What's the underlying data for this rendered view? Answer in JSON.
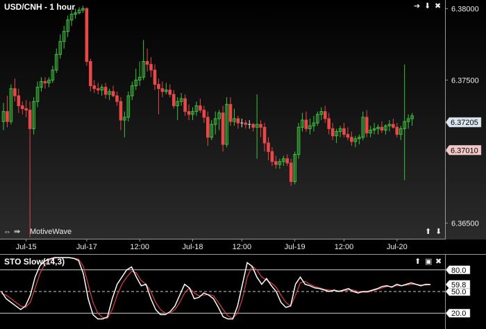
{
  "chart_data": {
    "type": "candlestick",
    "title": "USD/CNH - 1 hour",
    "watermark": "MotiveWave",
    "y_ticks": [
      "6.38000",
      "6.37500",
      "6.37000",
      "6.36500"
    ],
    "y_tick_values": [
      6.38,
      6.375,
      6.37,
      6.365
    ],
    "ylim": [
      6.3639,
      6.3806
    ],
    "x_ticks": [
      "Jul-15",
      "Jul-17",
      "12:00",
      "Jul-18",
      "12:00",
      "Jul-19",
      "12:00",
      "Jul-20"
    ],
    "x_tick_bar_index": [
      6,
      22,
      36,
      50,
      63,
      77,
      90,
      104
    ],
    "price_labels": [
      {
        "text": "6.37205",
        "value": 6.37205,
        "color": "#dce6f0"
      },
      {
        "text": "6.37010",
        "value": 6.3701,
        "color": "#f4c8c8"
      }
    ],
    "bullish_color": "#3ec43e",
    "bearish_color": "#e84848",
    "doji_color": "#e6e6e6",
    "candles_ohlc": [
      [
        6.3721,
        6.3734,
        6.3715,
        6.3728
      ],
      [
        6.3728,
        6.3739,
        6.3717,
        6.3721
      ],
      [
        6.3721,
        6.3747,
        6.3719,
        6.3744
      ],
      [
        6.3744,
        6.3751,
        6.3735,
        6.3739
      ],
      [
        6.3739,
        6.3744,
        6.3727,
        6.3732
      ],
      [
        6.3732,
        6.3735,
        6.3726,
        6.373
      ],
      [
        6.373,
        6.3736,
        6.3724,
        6.3729
      ],
      [
        6.3729,
        6.3735,
        6.364,
        6.3716
      ],
      [
        6.3716,
        6.3738,
        6.3712,
        6.3735
      ],
      [
        6.3735,
        6.3749,
        6.3731,
        6.3745
      ],
      [
        6.3745,
        6.3752,
        6.3742,
        6.3749
      ],
      [
        6.3749,
        6.3752,
        6.3744,
        6.3748
      ],
      [
        6.3748,
        6.3752,
        6.3745,
        6.375
      ],
      [
        6.375,
        6.376,
        6.3748,
        6.3757
      ],
      [
        6.3757,
        6.3772,
        6.3755,
        6.3768
      ],
      [
        6.3768,
        6.3782,
        6.3765,
        6.3777
      ],
      [
        6.3777,
        6.3788,
        6.3772,
        6.3784
      ],
      [
        6.3784,
        6.3795,
        6.378,
        6.3792
      ],
      [
        6.3792,
        6.3799,
        6.3788,
        6.3796
      ],
      [
        6.3796,
        6.38,
        6.3793,
        6.3797
      ],
      [
        6.3797,
        6.3801,
        6.3796,
        6.3799
      ],
      [
        6.3799,
        6.3802,
        6.3797,
        6.38
      ],
      [
        6.38,
        6.3801,
        6.376,
        6.3763
      ],
      [
        6.3763,
        6.3765,
        6.3742,
        6.3746
      ],
      [
        6.3746,
        6.375,
        6.3741,
        6.3744
      ],
      [
        6.3744,
        6.3748,
        6.374,
        6.3743
      ],
      [
        6.3743,
        6.3747,
        6.3739,
        6.3745
      ],
      [
        6.3745,
        6.3748,
        6.3737,
        6.374
      ],
      [
        6.374,
        6.3744,
        6.3736,
        6.3742
      ],
      [
        6.3742,
        6.3746,
        6.3738,
        6.3739
      ],
      [
        6.3739,
        6.3742,
        6.3732,
        6.3735
      ],
      [
        6.3735,
        6.3738,
        6.3715,
        6.3722
      ],
      [
        6.3722,
        6.3728,
        6.371,
        6.3724
      ],
      [
        6.3724,
        6.3742,
        6.3721,
        6.3739
      ],
      [
        6.3739,
        6.3749,
        6.3736,
        6.3746
      ],
      [
        6.3746,
        6.3758,
        6.3743,
        6.375
      ],
      [
        6.375,
        6.3763,
        6.3746,
        6.3752
      ],
      [
        6.3752,
        6.3778,
        6.375,
        6.3763
      ],
      [
        6.3763,
        6.3772,
        6.3756,
        6.3761
      ],
      [
        6.3761,
        6.3766,
        6.3752,
        6.3757
      ],
      [
        6.3757,
        6.3761,
        6.3743,
        6.3747
      ],
      [
        6.3747,
        6.3751,
        6.3726,
        6.3744
      ],
      [
        6.3744,
        6.3749,
        6.3738,
        6.3742
      ],
      [
        6.3742,
        6.3748,
        6.374,
        6.3743
      ],
      [
        6.3743,
        6.3747,
        6.3738,
        6.374
      ],
      [
        6.374,
        6.3743,
        6.373,
        6.3732
      ],
      [
        6.3732,
        6.3738,
        6.3722,
        6.3735
      ],
      [
        6.3735,
        6.3741,
        6.3732,
        6.3737
      ],
      [
        6.3737,
        6.374,
        6.3725,
        6.3728
      ],
      [
        6.3728,
        6.3733,
        6.3722,
        6.3726
      ],
      [
        6.3726,
        6.3731,
        6.3722,
        6.3728
      ],
      [
        6.3728,
        6.3735,
        6.3725,
        6.3732
      ],
      [
        6.3732,
        6.3737,
        6.3727,
        6.3729
      ],
      [
        6.3729,
        6.3732,
        6.372,
        6.3724
      ],
      [
        6.3724,
        6.3728,
        6.3704,
        6.371
      ],
      [
        6.371,
        6.3722,
        6.3708,
        6.3719
      ],
      [
        6.3719,
        6.3728,
        6.3712,
        6.3723
      ],
      [
        6.3723,
        6.3729,
        6.3715,
        6.3727
      ],
      [
        6.3727,
        6.3732,
        6.37,
        6.3705
      ],
      [
        6.3705,
        6.3738,
        6.3703,
        6.3733
      ],
      [
        6.3733,
        6.3738,
        6.3718,
        6.3721
      ],
      [
        6.3721,
        6.373,
        6.3718,
        6.3723
      ],
      [
        6.3723,
        6.3725,
        6.3716,
        6.372
      ],
      [
        6.372,
        6.3723,
        6.3717,
        6.372
      ],
      [
        6.372,
        6.3722,
        6.3716,
        6.3719
      ],
      [
        6.3719,
        6.3722,
        6.3716,
        6.3719
      ],
      [
        6.3719,
        6.372,
        6.3714,
        6.3717
      ],
      [
        6.3717,
        6.374,
        6.3695,
        6.3719
      ],
      [
        6.3719,
        6.3722,
        6.371,
        6.3717
      ],
      [
        6.3717,
        6.372,
        6.37,
        6.3706
      ],
      [
        6.3706,
        6.371,
        6.3694,
        6.37
      ],
      [
        6.37,
        6.3703,
        6.369,
        6.3693
      ],
      [
        6.3693,
        6.3697,
        6.3688,
        6.3691
      ],
      [
        6.3691,
        6.3695,
        6.3688,
        6.3693
      ],
      [
        6.3693,
        6.3697,
        6.369,
        6.3695
      ],
      [
        6.3695,
        6.3698,
        6.369,
        6.3692
      ],
      [
        6.3692,
        6.3695,
        6.3676,
        6.3679
      ],
      [
        6.3679,
        6.37,
        6.3677,
        6.3698
      ],
      [
        6.3698,
        6.372,
        6.3695,
        6.3717
      ],
      [
        6.3717,
        6.3727,
        6.3714,
        6.3722
      ],
      [
        6.3722,
        6.3728,
        6.3714,
        6.3716
      ],
      [
        6.3716,
        6.3723,
        6.3712,
        6.3718
      ],
      [
        6.3718,
        6.3725,
        6.3714,
        6.372
      ],
      [
        6.372,
        6.3728,
        6.3718,
        6.3726
      ],
      [
        6.3726,
        6.3731,
        6.3722,
        6.3728
      ],
      [
        6.3728,
        6.3732,
        6.372,
        6.3723
      ],
      [
        6.3723,
        6.3727,
        6.3712,
        6.3716
      ],
      [
        6.3716,
        6.372,
        6.3708,
        6.3711
      ],
      [
        6.3711,
        6.3716,
        6.3706,
        6.3714
      ],
      [
        6.3714,
        6.3718,
        6.371,
        6.3716
      ],
      [
        6.3716,
        6.372,
        6.371,
        6.3712
      ],
      [
        6.3712,
        6.3717,
        6.3708,
        6.371
      ],
      [
        6.371,
        6.3714,
        6.3704,
        6.3707
      ],
      [
        6.3707,
        6.3711,
        6.3703,
        6.3709
      ],
      [
        6.3709,
        6.3712,
        6.3705,
        6.371
      ],
      [
        6.371,
        6.3728,
        6.3708,
        6.3724
      ],
      [
        6.3724,
        6.3729,
        6.371,
        6.3713
      ],
      [
        6.3713,
        6.3718,
        6.371,
        6.3715
      ],
      [
        6.3715,
        6.372,
        6.3712,
        6.3716
      ],
      [
        6.3716,
        6.3719,
        6.3712,
        6.3717
      ],
      [
        6.3717,
        6.3721,
        6.3713,
        6.3715
      ],
      [
        6.3715,
        6.3719,
        6.3712,
        6.3718
      ],
      [
        6.3718,
        6.3722,
        6.3714,
        6.3719
      ],
      [
        6.3719,
        6.3723,
        6.3716,
        6.3717
      ],
      [
        6.3717,
        6.372,
        6.371,
        6.3712
      ],
      [
        6.3712,
        6.3718,
        6.3708,
        6.3716
      ],
      [
        6.3716,
        6.3761,
        6.368,
        6.3721
      ],
      [
        6.3721,
        6.3726,
        6.3716,
        6.3723
      ],
      [
        6.3723,
        6.3727,
        6.3718,
        6.3725
      ]
    ],
    "oscillator": {
      "title": "STO Slow(14,3)",
      "ylim": [
        0,
        100
      ],
      "levels": [
        {
          "label": "80.0",
          "value": 80,
          "style": "solid"
        },
        {
          "label": "50.0",
          "value": 50,
          "style": "dashed"
        },
        {
          "label": "20.0",
          "value": 20,
          "style": "solid"
        }
      ],
      "current_label": "59.8",
      "current_value": 59.8,
      "k_color": "#ffffff",
      "d_color": "#e04040",
      "k_values": [
        50,
        40,
        35,
        30,
        25,
        30,
        45,
        70,
        86,
        92,
        95,
        97,
        97,
        97,
        97,
        96,
        93,
        75,
        40,
        18,
        12,
        12,
        15,
        40,
        60,
        70,
        80,
        84,
        70,
        58,
        60,
        40,
        25,
        18,
        18,
        22,
        30,
        45,
        60,
        55,
        40,
        42,
        48,
        45,
        40,
        28,
        15,
        12,
        12,
        30,
        60,
        90,
        85,
        70,
        60,
        68,
        58,
        50,
        35,
        28,
        30,
        60,
        70,
        60,
        58,
        55,
        54,
        52,
        50,
        52,
        50,
        52,
        54,
        50,
        48,
        50,
        50,
        52,
        54,
        57,
        58,
        56,
        60,
        58,
        60,
        62,
        60,
        58,
        60,
        59.8
      ],
      "d_values": [
        47,
        45,
        40,
        35,
        30,
        28,
        35,
        55,
        75,
        88,
        93,
        96,
        97,
        97,
        97,
        96,
        95,
        85,
        60,
        35,
        20,
        14,
        13,
        25,
        45,
        60,
        70,
        78,
        76,
        65,
        60,
        50,
        35,
        25,
        20,
        20,
        25,
        35,
        48,
        55,
        48,
        44,
        45,
        46,
        44,
        35,
        25,
        16,
        13,
        20,
        40,
        70,
        85,
        80,
        70,
        66,
        62,
        56,
        45,
        35,
        30,
        45,
        62,
        64,
        60,
        57,
        55,
        53,
        52,
        51,
        51,
        51,
        52,
        52,
        50,
        49,
        49,
        51,
        53,
        55,
        57,
        57,
        58,
        58,
        59,
        60,
        60,
        59,
        59,
        59.5
      ]
    }
  }
}
